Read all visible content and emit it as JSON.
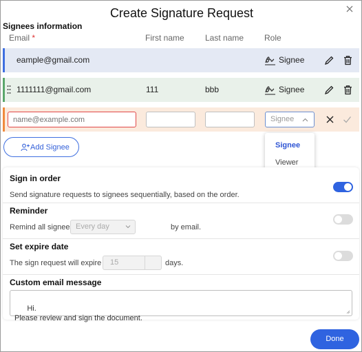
{
  "dialog": {
    "title": "Create Signature Request",
    "close_icon": "close-icon"
  },
  "signees": {
    "heading": "Signees information",
    "columns": {
      "email": "Email",
      "required_mark": "*",
      "first_name": "First name",
      "last_name": "Last name",
      "role": "Role"
    },
    "rows": [
      {
        "email": "eample@gmail.com",
        "first_name": "",
        "last_name": "",
        "role": "Signee",
        "accent": "#3f6fe0",
        "background": "#e4e9f4"
      },
      {
        "email": "1111111@gmail.com",
        "first_name": "111",
        "last_name": "bbb",
        "role": "Signee",
        "accent": "#5aa66b",
        "background": "#e9f1ea"
      }
    ],
    "new_row": {
      "email_placeholder": "name@example.com",
      "first_name_value": "",
      "last_name_value": "",
      "role_value": "Signee",
      "accent": "#f08a3c",
      "background": "#fbeadd"
    },
    "role_options": [
      {
        "label": "Signee",
        "selected": true
      },
      {
        "label": "Viewer",
        "selected": false
      }
    ],
    "add_button_label": "Add Signee"
  },
  "settings": {
    "sign_in_order": {
      "title": "Sign in order",
      "description": "Send signature requests to signees sequentially, based on the order.",
      "enabled": true
    },
    "reminder": {
      "title": "Reminder",
      "prefix": "Remind all signees",
      "frequency": "Every day",
      "suffix": "by email.",
      "enabled": false
    },
    "expire": {
      "title": "Set expire date",
      "prefix": "The sign request will expire in",
      "days": "15",
      "suffix": "days.",
      "enabled": false
    },
    "message": {
      "title": "Custom email message",
      "body": "Hi.\nPlease review and sign the document."
    }
  },
  "footer": {
    "done_label": "Done"
  },
  "colors": {
    "primary": "#2f63e0",
    "error": "#e04848"
  }
}
